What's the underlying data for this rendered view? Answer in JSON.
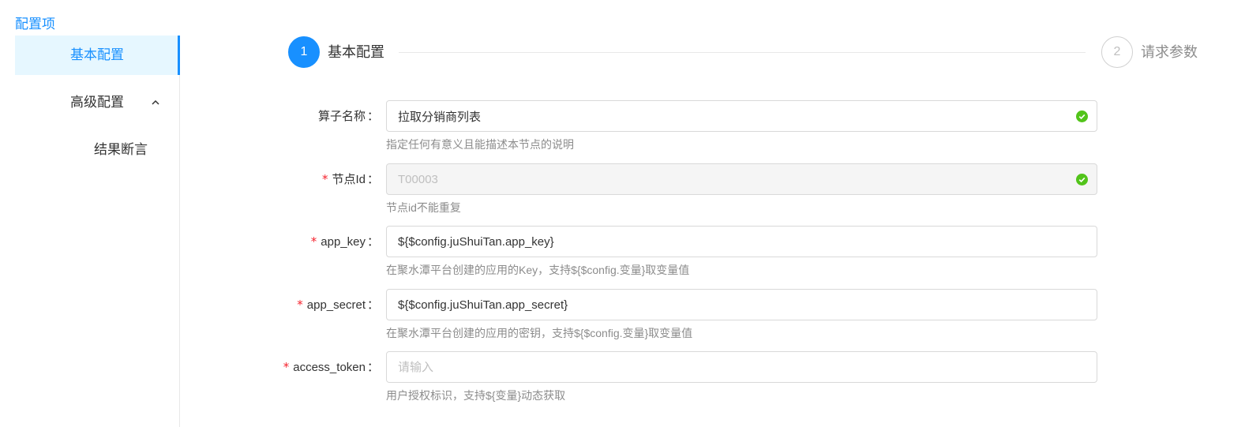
{
  "sidebar": {
    "title": "配置项",
    "items": [
      {
        "label": "基本配置"
      },
      {
        "label": "高级配置"
      },
      {
        "label": "结果断言"
      }
    ]
  },
  "steps": [
    {
      "number": "1",
      "title": "基本配置",
      "status": "active"
    },
    {
      "number": "2",
      "title": "请求参数",
      "status": "wait"
    }
  ],
  "form": {
    "fields": [
      {
        "label": "算子名称",
        "required": "",
        "value": "拉取分销商列表",
        "placeholder": "",
        "help": "指定任何有意义且能描述本节点的说明",
        "valid": true
      },
      {
        "label": "节点Id",
        "required": "*",
        "value": "T00003",
        "placeholder": "",
        "help": "节点id不能重复",
        "valid": true
      },
      {
        "label": "app_key",
        "required": "*",
        "value": "${$config.juShuiTan.app_key}",
        "placeholder": "",
        "help": "在聚水潭平台创建的应用的Key，支持${$config.变量}取变量值"
      },
      {
        "label": "app_secret",
        "required": "*",
        "value": "${$config.juShuiTan.app_secret}",
        "placeholder": "",
        "help": "在聚水潭平台创建的应用的密钥，支持${$config.变量}取变量值"
      },
      {
        "label": "access_token",
        "required": "*",
        "value": "",
        "placeholder": "请输入",
        "help": "用户授权标识，支持${变量}动态获取"
      }
    ],
    "colon": "："
  },
  "colors": {
    "accent": "#1890ff",
    "success": "#52c41a",
    "required": "#f5222d"
  },
  "icons": {
    "collapse": "chevron-up-icon",
    "valid": "check-circle-icon"
  }
}
